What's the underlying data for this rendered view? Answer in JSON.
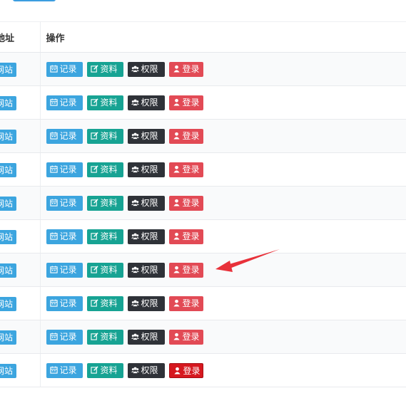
{
  "header": {
    "col_address": "地址",
    "col_actions": "操作"
  },
  "rows": [
    {
      "site": "网站",
      "record": "记录",
      "profile": "资料",
      "permission": "权限",
      "login": "登录"
    },
    {
      "site": "网站",
      "record": "记录",
      "profile": "资料",
      "permission": "权限",
      "login": "登录"
    },
    {
      "site": "网站",
      "record": "记录",
      "profile": "资料",
      "permission": "权限",
      "login": "登录"
    },
    {
      "site": "网站",
      "record": "记录",
      "profile": "资料",
      "permission": "权限",
      "login": "登录"
    },
    {
      "site": "网站",
      "record": "记录",
      "profile": "资料",
      "permission": "权限",
      "login": "登录"
    },
    {
      "site": "网站",
      "record": "记录",
      "profile": "资料",
      "permission": "权限",
      "login": "登录"
    },
    {
      "site": "网站",
      "record": "记录",
      "profile": "资料",
      "permission": "权限",
      "login": "登录"
    },
    {
      "site": "网站",
      "record": "记录",
      "profile": "资料",
      "permission": "权限",
      "login": "登录"
    },
    {
      "site": "网站",
      "record": "记录",
      "profile": "资料",
      "permission": "权限",
      "login": "登录"
    },
    {
      "site": "网站",
      "record": "记录",
      "profile": "资料",
      "permission": "权限",
      "login": "登录"
    }
  ],
  "annotation": {
    "arrow_color": "#e8313a",
    "points_to_row": 7
  },
  "colors": {
    "record": "#3ca5df",
    "profile": "#17a393",
    "permission": "#2f3238",
    "login": "#e24a55",
    "login_active": "#d6181f"
  },
  "icons": {
    "record": "calendar-icon",
    "profile": "edit-icon",
    "permission": "users-icon",
    "login": "user-icon"
  }
}
